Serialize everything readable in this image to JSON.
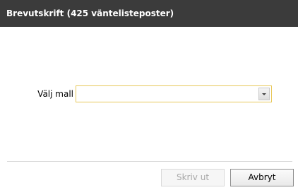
{
  "dialog": {
    "title": "Brevutskrift (425 väntelisteposter)"
  },
  "template_select": {
    "label": "Välj mall",
    "value": ""
  },
  "buttons": {
    "print_label": "Skriv ut",
    "print_enabled": false,
    "cancel_label": "Avbryt"
  },
  "colors": {
    "titlebar_bg": "#3b3b3b",
    "focus_border": "#e8c85a"
  },
  "icons": {
    "dropdown": "chevron-down-icon"
  }
}
